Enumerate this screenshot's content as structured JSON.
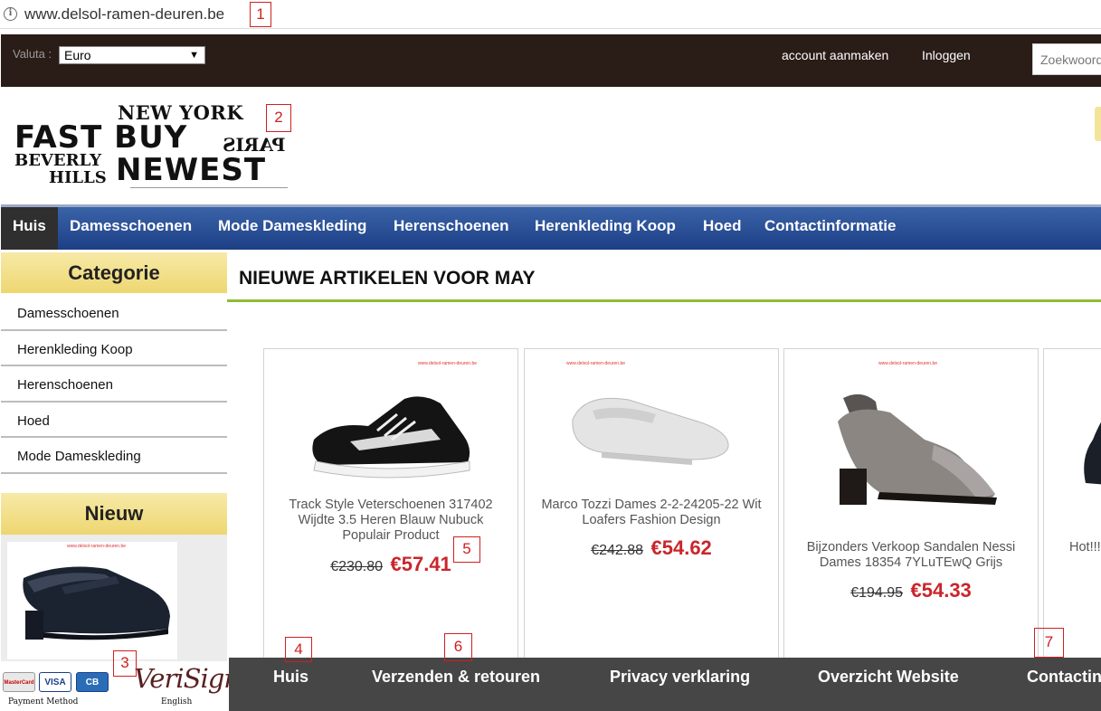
{
  "browser": {
    "url": "www.delsol-ramen-deuren.be"
  },
  "markers": [
    "1",
    "2",
    "3",
    "4",
    "5",
    "6",
    "7"
  ],
  "topbar": {
    "currency_label": "Valuta :",
    "currency_value": "Euro",
    "create_account": "account aanmaken",
    "login": "Inloggen",
    "search_placeholder": "Zoekwoord"
  },
  "logo": {
    "line1": "NEW YORK",
    "line2": "FAST BUY",
    "line3": "PARIS",
    "line4": "BEVERLY",
    "line5": "HILLS",
    "line6": "NEWEST"
  },
  "nav": [
    "Huis",
    "Damesschoenen",
    "Mode Dameskleding",
    "Herenschoenen",
    "Herenkleding Koop",
    "Hoed",
    "Contactinformatie"
  ],
  "sidebar": {
    "category_title": "Categorie",
    "categories": [
      "Damesschoenen",
      "Herenkleding Koop",
      "Herenschoenen",
      "Hoed",
      "Mode Dameskleding"
    ],
    "new_title": "Nieuw",
    "watermark": "www.delsol-ramen-deuren.be"
  },
  "payment": {
    "cards": [
      "MasterCard",
      "VISA",
      "CB"
    ],
    "caption": "Payment Method",
    "verisign": "VeriSign",
    "language": "English"
  },
  "main": {
    "title": "NIEUWE ARTIKELEN VOOR MAY",
    "products": [
      {
        "name": "Track Style Veterschoenen 317402 Wijdte 3.5 Heren Blauw Nubuck Populair Product",
        "old_price": "€230.80",
        "new_price": "€57.41"
      },
      {
        "name": "Marco Tozzi Dames 2-2-24205-22 Wit Loafers Fashion Design",
        "old_price": "€242.88",
        "new_price": "€54.62"
      },
      {
        "name": "Bijzonders Verkoop Sandalen Nessi Dames 18354 7YLuTEwQ Grijs",
        "old_price": "€194.95",
        "new_price": "€54.33"
      },
      {
        "name": "Hot!!! G",
        "old_price": "",
        "new_price": ""
      }
    ]
  },
  "footer": [
    "Huis",
    "Verzenden & retouren",
    "Privacy verklaring",
    "Overzicht Website",
    "Contactin"
  ],
  "colors": {
    "nav_blue": "#1c3f86",
    "topbar": "#2a1c17",
    "price_red": "#c9262b",
    "accent_green": "#8dbd32",
    "sidebar_yellow": "#eed670"
  }
}
